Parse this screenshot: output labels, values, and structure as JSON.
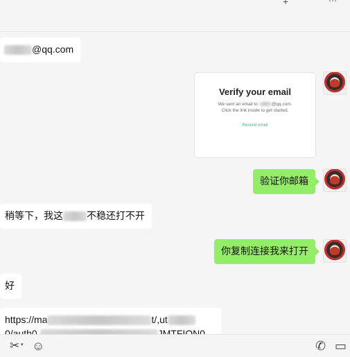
{
  "header": {
    "add_icon": "+",
    "more_icon": "⋯"
  },
  "messages": [
    {
      "side": "left",
      "type": "text",
      "text": "@qq.com"
    },
    {
      "side": "right",
      "type": "card",
      "card": {
        "title": "Verify your email",
        "line1_pre": "We sent an email to",
        "line1_post": "@qq.com.",
        "line2": "Click the link inside to get started.",
        "link": "Resend email"
      }
    },
    {
      "side": "right",
      "type": "text",
      "text": "验证你邮箱"
    },
    {
      "side": "left",
      "type": "text",
      "text_pre": "稍等下，我这",
      "text_post": "不稳还打不开"
    },
    {
      "side": "right",
      "type": "text",
      "text": "你复制连接我来打开"
    },
    {
      "side": "left",
      "type": "text",
      "text": "好"
    },
    {
      "side": "left",
      "type": "link",
      "line1": "https://ma",
      "line1_tail": "t/,ut",
      "line2": "0/auth0.",
      "line2_tail": "JMTFION0"
    }
  ],
  "toolbar": {
    "scissors_icon": "✂",
    "emoji_icon": "☺",
    "phone_icon": "✆",
    "video_icon": "▭"
  }
}
